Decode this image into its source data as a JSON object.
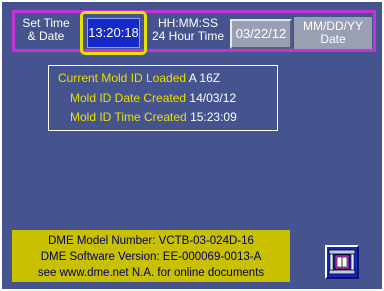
{
  "time_date": {
    "set_label": [
      "Set Time",
      "& Date"
    ],
    "time_value": "13:20:18",
    "time_format": [
      "HH:MM:SS",
      "24 Hour Time"
    ],
    "date_value": "03/22/12",
    "date_format": [
      "MM/DD/YY",
      "Date"
    ]
  },
  "mold_info": {
    "loaded_label": "Current Mold ID Loaded",
    "loaded_value": "A 16Z",
    "date_label": "Mold ID Date Created",
    "date_value": "14/03/12",
    "time_label": "Mold ID Time Created",
    "time_value": "15:23:09"
  },
  "dme": {
    "model_line": "DME Model Number:  VCTB-03-024D-16",
    "software_line": "DME Software Version: EE-000069-0013-A",
    "web_line": "see www.dme.net N.A. for online documents"
  },
  "icons": {
    "mold_button": "mold-icon"
  },
  "colors": {
    "background": "#45538f",
    "highlight": "#e8e000",
    "frame": "#c830d8",
    "button": "#1429c8"
  }
}
